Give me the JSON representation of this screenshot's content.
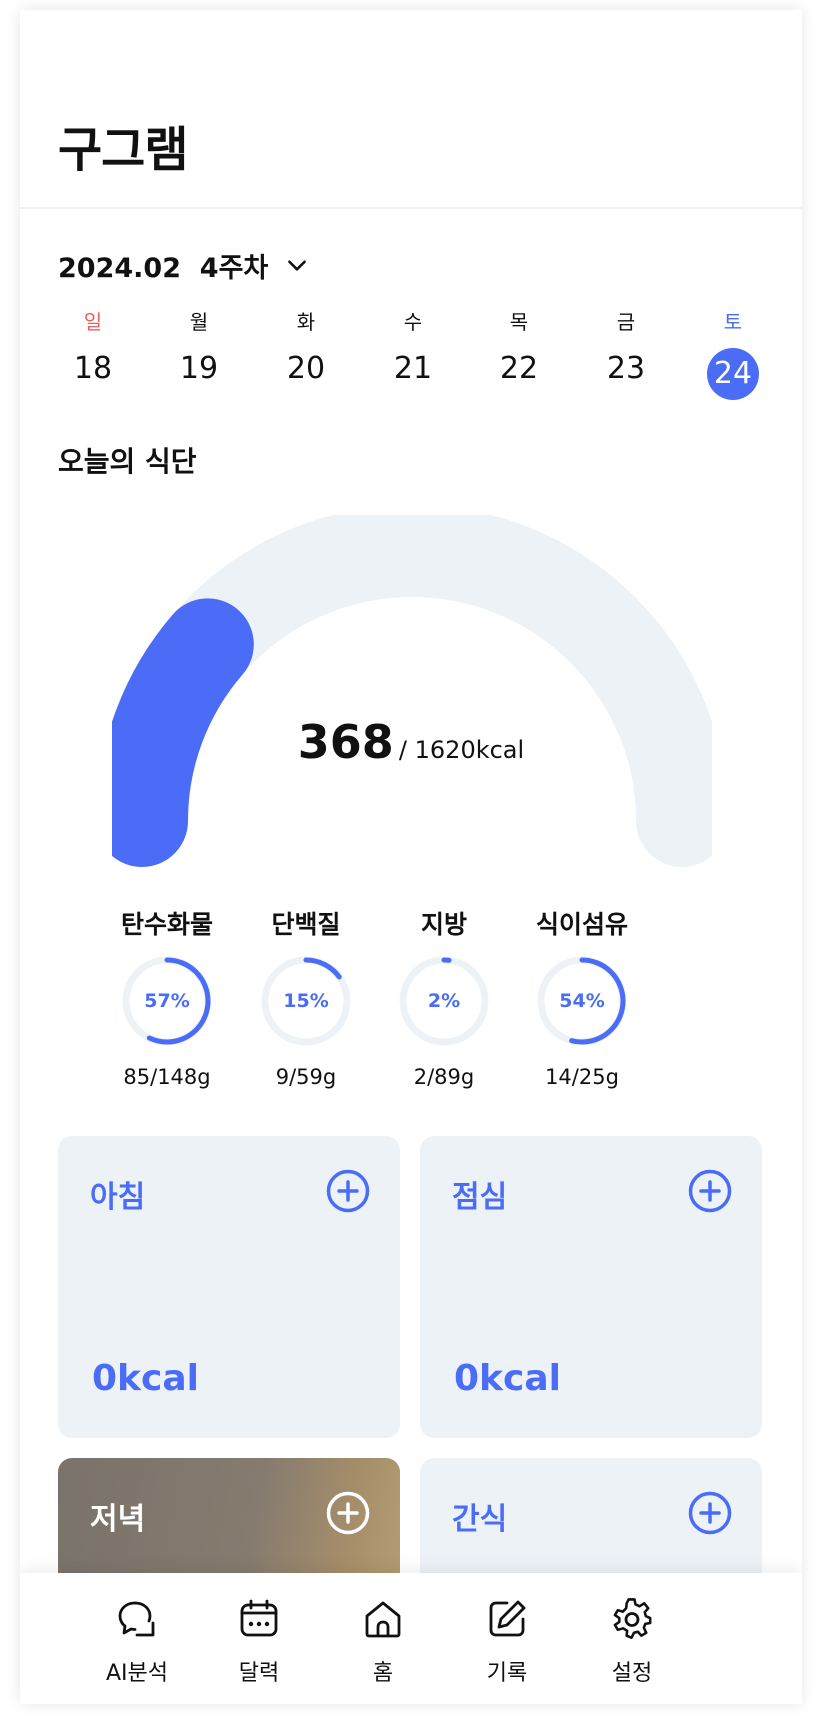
{
  "app": {
    "title": "구그램"
  },
  "week": {
    "label": "2024.02  4주차",
    "dropdown_icon": "chevron-down-icon"
  },
  "days": [
    {
      "name": "일",
      "num": "18"
    },
    {
      "name": "월",
      "num": "19"
    },
    {
      "name": "화",
      "num": "20"
    },
    {
      "name": "수",
      "num": "21"
    },
    {
      "name": "목",
      "num": "22"
    },
    {
      "name": "금",
      "num": "23"
    },
    {
      "name": "토",
      "num": "24",
      "selected": true
    }
  ],
  "today": {
    "title": "오늘의 식단",
    "kcal_current": "368",
    "kcal_goal": "/ 1620kcal",
    "progress_fraction": 0.227
  },
  "nutrients": [
    {
      "label": "탄수화물",
      "percent": "57%",
      "amount": "85/148g",
      "fraction": 0.57
    },
    {
      "label": "단백질",
      "percent": "15%",
      "amount": "9/59g",
      "fraction": 0.15
    },
    {
      "label": "지방",
      "percent": "2%",
      "amount": "2/89g",
      "fraction": 0.02
    },
    {
      "label": "식이섬유",
      "percent": "54%",
      "amount": "14/25g",
      "fraction": 0.54
    }
  ],
  "meals": {
    "breakfast": {
      "label": "아침",
      "kcal": "0kcal"
    },
    "lunch": {
      "label": "점심",
      "kcal": "0kcal"
    },
    "dinner": {
      "label": "저녁"
    },
    "snack": {
      "label": "간식"
    }
  },
  "tabs": [
    {
      "label": "AI분석",
      "icon": "chat-icon"
    },
    {
      "label": "달력",
      "icon": "calendar-icon"
    },
    {
      "label": "홈",
      "icon": "home-icon"
    },
    {
      "label": "기록",
      "icon": "edit-icon"
    },
    {
      "label": "설정",
      "icon": "gear-icon"
    }
  ],
  "colors": {
    "accent": "#4a6cf7",
    "track": "#edf2f7",
    "sunday": "#ef5d5d",
    "saturday": "#4a6cf7"
  }
}
